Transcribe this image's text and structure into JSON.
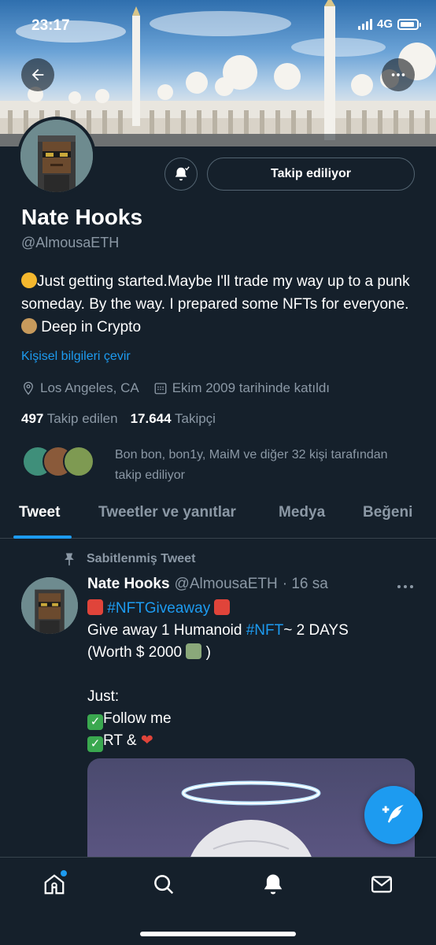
{
  "status_bar": {
    "time": "23:17",
    "network": "4G"
  },
  "profile": {
    "name": "Nate Hooks",
    "handle": "@AlmousaETH",
    "follow_button_label": "Takip ediliyor",
    "bio": "Just getting started.Maybe I'll trade my way up to a punk someday. By the way. I prepared some NFTs for everyone. ",
    "bio_end": "Deep in Crypto",
    "translate_link": "Kişisel bilgileri çevir",
    "location": "Los Angeles, CA",
    "joined": "Ekim 2009 tarihinde katıldı",
    "following_count": "497",
    "following_label": "Takip edilen",
    "followers_count": "17.644",
    "followers_label": "Takipçi",
    "followed_by_text": "Bon bon, bon1y, MaiM ve diğer 32 kişi tarafından takip ediliyor"
  },
  "tabs": [
    {
      "label": "Tweet"
    },
    {
      "label": "Tweetler ve yanıtlar"
    },
    {
      "label": "Medya"
    },
    {
      "label": "Beğeni"
    }
  ],
  "pinned_tweet": {
    "pinned_label": "Sabitlenmiş Tweet",
    "author_name": "Nate Hooks",
    "author_handle": "@AlmousaETH",
    "time": "· 16 sa",
    "hashtag1": "#NFTGiveaway",
    "line1_pre": "Give away 1 Humanoid ",
    "hashtag2": "#NFT",
    "line1_post": "~ 2 DAYS",
    "line2": "(Worth $ 2000 ",
    "line2_end": " )",
    "line3": "Just:",
    "line4": "Follow me",
    "line5": "RT & "
  },
  "icons": {
    "back": "arrow-left-icon",
    "more": "more-icon",
    "bell": "bell-icon",
    "location": "location-pin-icon",
    "calendar": "calendar-icon",
    "pin": "pin-icon",
    "compose": "compose-icon",
    "home": "home-icon",
    "search": "search-icon",
    "notifications": "bell-icon",
    "messages": "mail-icon"
  },
  "colors": {
    "accent": "#1d9bf0",
    "background": "#15202b",
    "muted": "#8b98a5"
  }
}
